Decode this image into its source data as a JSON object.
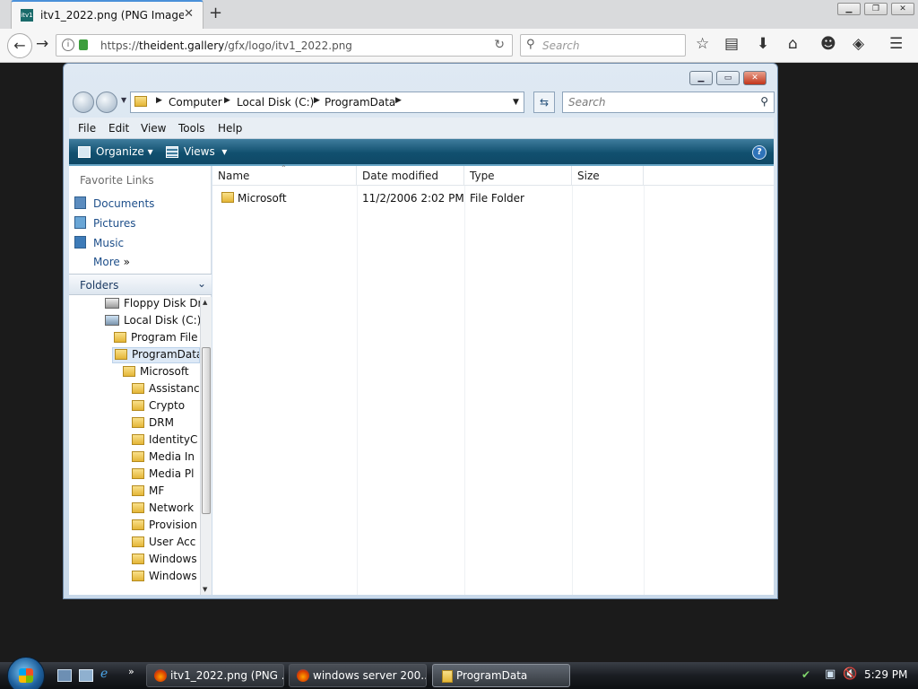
{
  "browser": {
    "tab_title": "itv1_2022.png (PNG Image,...",
    "tab_favicon_text": "itv1",
    "url_scheme": "https://",
    "url_host": "theident.gallery",
    "url_path": "/gfx/logo/itv1_2022.png",
    "search_placeholder": "Search"
  },
  "explorer": {
    "breadcrumb": [
      "Computer",
      "Local Disk (C:)",
      "ProgramData"
    ],
    "search_placeholder": "Search",
    "menu": [
      "File",
      "Edit",
      "View",
      "Tools",
      "Help"
    ],
    "commands": {
      "organize": "Organize",
      "views": "Views"
    },
    "favorites_header": "Favorite Links",
    "favorites": [
      "Documents",
      "Pictures",
      "Music"
    ],
    "more_label": "More",
    "folders_header": "Folders",
    "tree": [
      {
        "label": "Floppy Disk Dr",
        "kind": "drive"
      },
      {
        "label": "Local Disk (C:)",
        "kind": "drive"
      },
      {
        "label": "Program File",
        "kind": "folder"
      },
      {
        "label": "ProgramData",
        "kind": "folder",
        "selected": true
      },
      {
        "label": "Microsoft",
        "kind": "folder"
      },
      {
        "label": "Assistanc",
        "kind": "folder"
      },
      {
        "label": "Crypto",
        "kind": "folder"
      },
      {
        "label": "DRM",
        "kind": "folder"
      },
      {
        "label": "IdentityC",
        "kind": "folder"
      },
      {
        "label": "Media In",
        "kind": "folder"
      },
      {
        "label": "Media Pl",
        "kind": "folder"
      },
      {
        "label": "MF",
        "kind": "folder"
      },
      {
        "label": "Network",
        "kind": "folder"
      },
      {
        "label": "Provision",
        "kind": "folder"
      },
      {
        "label": "User Acc",
        "kind": "folder"
      },
      {
        "label": "Windows",
        "kind": "folder"
      },
      {
        "label": "Windows",
        "kind": "folder"
      }
    ],
    "columns": [
      "Name",
      "Date modified",
      "Type",
      "Size"
    ],
    "rows": [
      {
        "name": "Microsoft",
        "date": "11/2/2006 2:02 PM",
        "type": "File Folder",
        "size": ""
      }
    ]
  },
  "taskbar": {
    "buttons": [
      "itv1_2022.png (PNG ...",
      "windows server 200...",
      "ProgramData"
    ],
    "clock": "5:29 PM"
  }
}
